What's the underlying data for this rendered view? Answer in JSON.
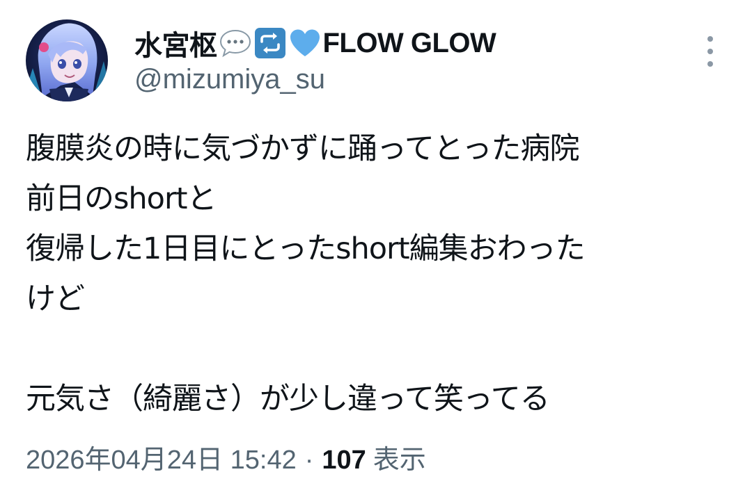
{
  "user": {
    "display_name_prefix": "水宮枢",
    "display_name_suffix": "FLOW GLOW",
    "name_emoji": [
      "speech-bubble-emoji",
      "repeat-emoji",
      "blue-heart-emoji"
    ],
    "handle": "@mizumiya_su"
  },
  "tweet": {
    "text": "腹膜炎の時に気づかずに踊ってとった病院\n前日のshortと\n復帰した1日目にとったshort編集おわった\nけど\n\n元気さ（綺麗さ）が少し違って笑ってる",
    "timestamp": "2026年04月24日 15:42",
    "separator": "·",
    "views_count": "107",
    "views_label": "表示"
  },
  "colors": {
    "primary_text": "#0f1419",
    "secondary_text": "#536471",
    "icon_gray": "#8b98a5",
    "emoji_blue": "#3b88c3",
    "heart_blue": "#5dadec"
  },
  "icons": {
    "more": "vertical-ellipsis-icon",
    "avatar": "avatar"
  }
}
